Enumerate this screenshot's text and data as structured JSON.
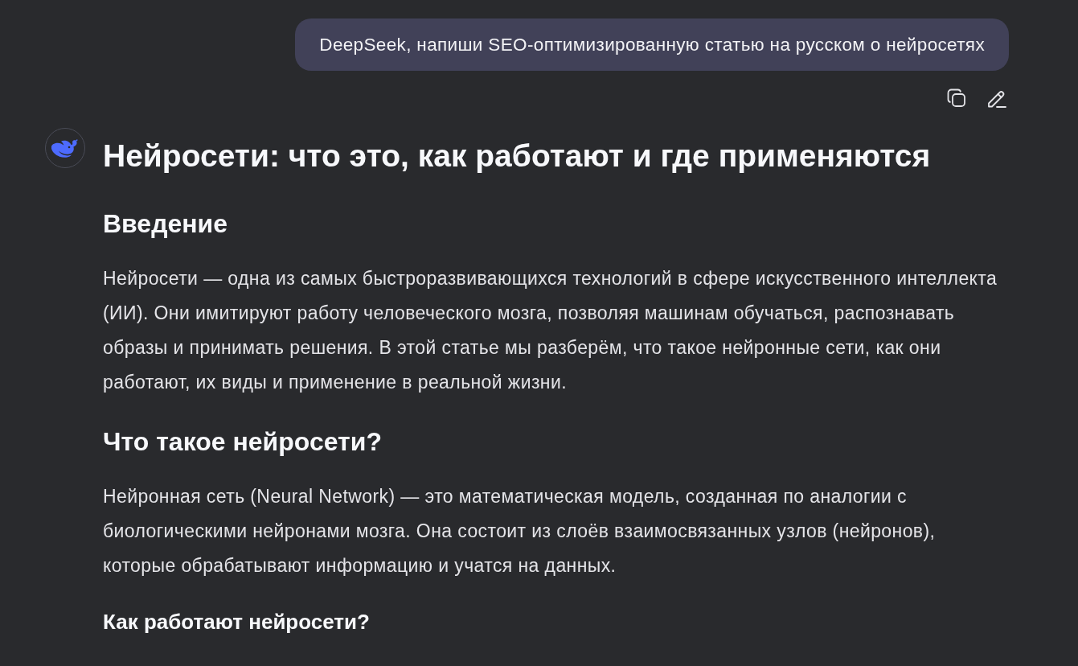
{
  "user_message": {
    "text": "DeepSeek, напиши SEO-оптимизированную статью на русском о нейросетях"
  },
  "assistant_message": {
    "title": "Нейросети: что это, как работают и где применяются",
    "blocks": [
      {
        "kind": "h2",
        "text": "Введение"
      },
      {
        "kind": "paragraph",
        "lines": [
          "Нейросети — одна из самых быстроразвивающихся технологий в сфере искусственного интеллекта",
          "(ИИ). Они имитируют работу человеческого мозга, позволяя машинам обучаться, распознавать",
          "образы и принимать решения. В этой статье мы разберём, что такое нейронные сети, как они",
          "работают, их виды и применение в реальной жизни."
        ]
      },
      {
        "kind": "h2",
        "text": "Что такое нейросети?"
      },
      {
        "kind": "paragraph",
        "lines": [
          "Нейронная сеть (Neural Network) — это математическая модель, созданная по аналогии с",
          "биологическими нейронами мозга. Она состоит из слоёв взаимосвязанных узлов (нейронов),",
          "которые обрабатывают информацию и учатся на данных."
        ]
      },
      {
        "kind": "h3",
        "text": "Как работают нейросети?"
      }
    ]
  }
}
